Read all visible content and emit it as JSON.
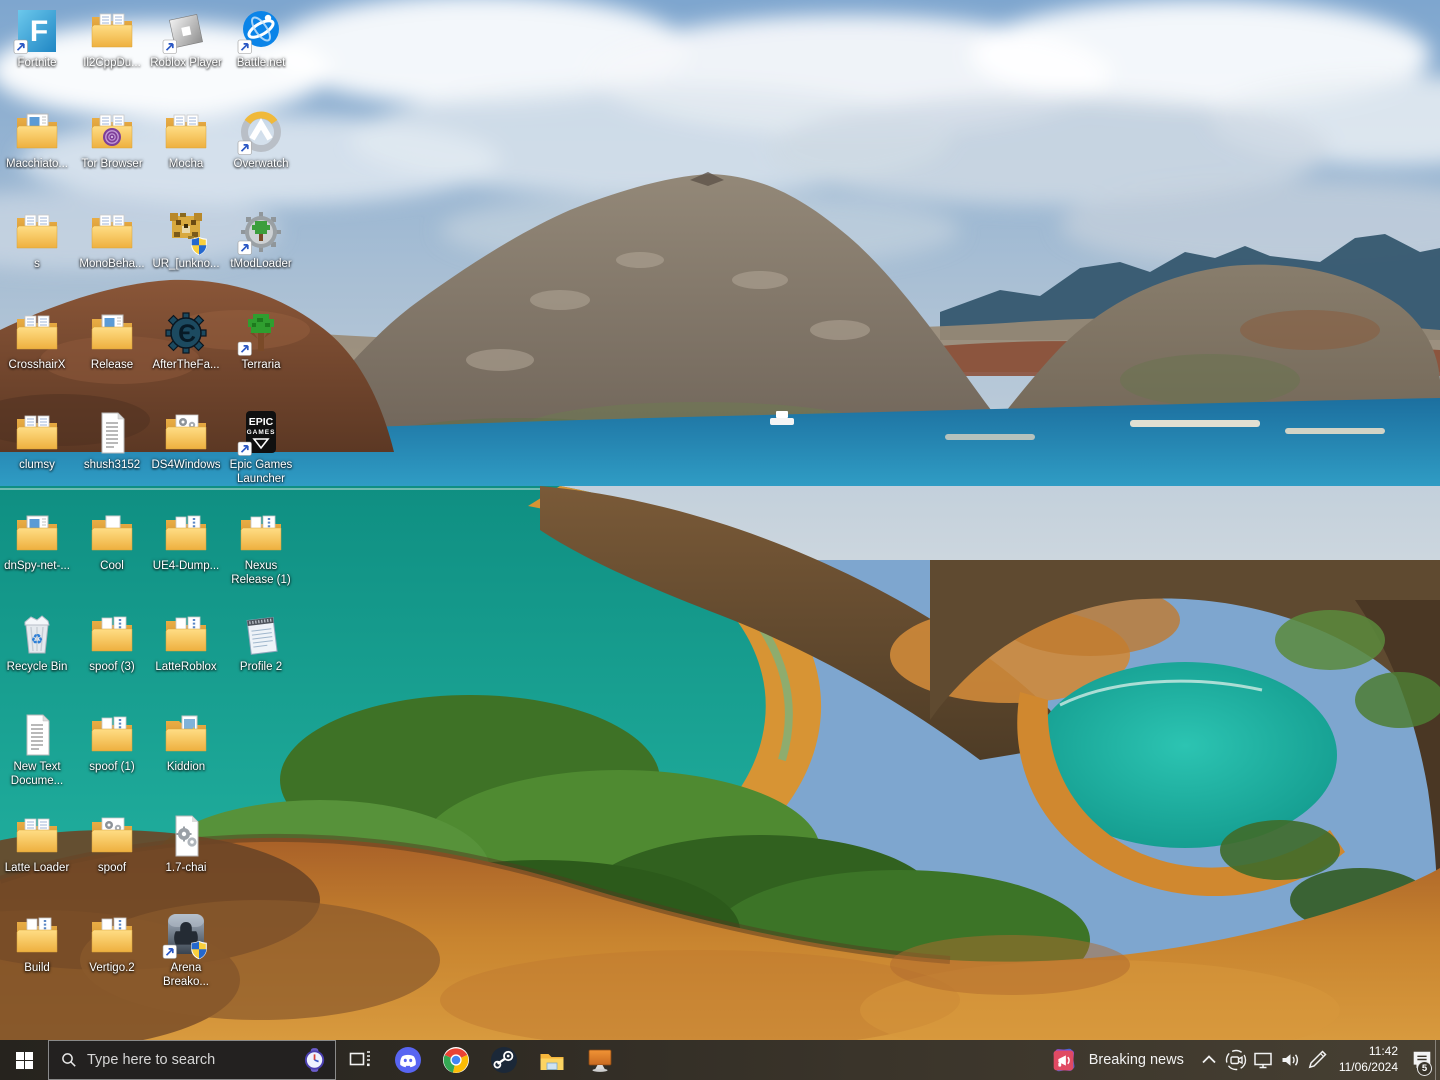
{
  "desktop": {
    "wallpaper": {
      "description": "Bartolome Island Galapagos: cloudy blue sky, distant blue peaks, tan volcanic cone, twin turquoise bays with orange crescent beaches, green scrub, golden volcanic foreground slope, small white boat on the blue channel",
      "palette": {
        "sky_top": "#7ea6cf",
        "sky_bottom": "#ccd6de",
        "ocean": "#1c6f9f",
        "bay_teal": "#12998a",
        "beach_orange": "#d79434",
        "vegetation": "#3e7226",
        "foreground_orange": "#c8842f",
        "volcano_tan": "#8d8275",
        "ridge_brown": "#7e4c34"
      }
    },
    "icons": [
      {
        "id": "fortnite",
        "label": "Fortnite",
        "type": "tile-fortnite",
        "col": 0,
        "row": 0,
        "shortcut": true,
        "shield": false
      },
      {
        "id": "il2cppdu",
        "label": "Il2CppDu...",
        "type": "folder-doc",
        "col": 1,
        "row": 0,
        "shortcut": false,
        "shield": false
      },
      {
        "id": "roblox-player",
        "label": "Roblox Player",
        "type": "tile-roblox",
        "col": 2,
        "row": 0,
        "shortcut": true,
        "shield": false
      },
      {
        "id": "battlenet",
        "label": "Battle.net",
        "type": "tile-battlenet",
        "col": 3,
        "row": 0,
        "shortcut": true,
        "shield": false
      },
      {
        "id": "macchiato",
        "label": "Macchiato...",
        "type": "folder-app",
        "col": 0,
        "row": 1,
        "shortcut": false,
        "shield": false
      },
      {
        "id": "tor-browser",
        "label": "Tor Browser",
        "type": "folder-tor",
        "col": 1,
        "row": 1,
        "shortcut": false,
        "shield": false
      },
      {
        "id": "mocha",
        "label": "Mocha",
        "type": "folder-doc",
        "col": 2,
        "row": 1,
        "shortcut": false,
        "shield": false
      },
      {
        "id": "overwatch",
        "label": "Overwatch",
        "type": "tile-overwatch",
        "col": 3,
        "row": 1,
        "shortcut": true,
        "shield": false
      },
      {
        "id": "s",
        "label": "s",
        "type": "folder-doc",
        "col": 0,
        "row": 2,
        "shortcut": false,
        "shield": false
      },
      {
        "id": "monobeha",
        "label": "MonoBeha...",
        "type": "folder-doc",
        "col": 1,
        "row": 2,
        "shortcut": false,
        "shield": false
      },
      {
        "id": "ur-unknown",
        "label": "UR_[unkno...",
        "type": "tile-leopard",
        "col": 2,
        "row": 2,
        "shortcut": false,
        "shield": true
      },
      {
        "id": "tmodloader",
        "label": "tModLoader",
        "type": "tile-tmod",
        "col": 3,
        "row": 2,
        "shortcut": true,
        "shield": false
      },
      {
        "id": "crosshairx",
        "label": "CrosshairX",
        "type": "folder-doc",
        "col": 0,
        "row": 3,
        "shortcut": false,
        "shield": false
      },
      {
        "id": "release",
        "label": "Release",
        "type": "folder-app",
        "col": 1,
        "row": 3,
        "shortcut": false,
        "shield": false
      },
      {
        "id": "afterthefa",
        "label": "AfterTheFa...",
        "type": "tile-cheatengine",
        "col": 2,
        "row": 3,
        "shortcut": false,
        "shield": false
      },
      {
        "id": "terraria",
        "label": "Terraria",
        "type": "tile-terraria",
        "col": 3,
        "row": 3,
        "shortcut": true,
        "shield": false
      },
      {
        "id": "clumsy",
        "label": "clumsy",
        "type": "folder-doc",
        "col": 0,
        "row": 4,
        "shortcut": false,
        "shield": false
      },
      {
        "id": "shush3152",
        "label": "shush3152",
        "type": "doc-text",
        "col": 1,
        "row": 4,
        "shortcut": false,
        "shield": false
      },
      {
        "id": "ds4windows",
        "label": "DS4Windows",
        "type": "folder-gear",
        "col": 2,
        "row": 4,
        "shortcut": false,
        "shield": false
      },
      {
        "id": "epic-games-launcher",
        "label": "Epic Games Launcher",
        "type": "tile-epic",
        "col": 3,
        "row": 4,
        "shortcut": true,
        "shield": false
      },
      {
        "id": "dnspy",
        "label": "dnSpy-net-...",
        "type": "folder-app",
        "col": 0,
        "row": 5,
        "shortcut": false,
        "shield": false
      },
      {
        "id": "cool",
        "label": "Cool",
        "type": "folder-blank",
        "col": 1,
        "row": 5,
        "shortcut": false,
        "shield": false
      },
      {
        "id": "ue4-dump",
        "label": "UE4-Dump...",
        "type": "folder-list",
        "col": 2,
        "row": 5,
        "shortcut": false,
        "shield": false
      },
      {
        "id": "nexus-release",
        "label": "Nexus Release (1)",
        "type": "folder-list",
        "col": 3,
        "row": 5,
        "shortcut": false,
        "shield": false
      },
      {
        "id": "recycle-bin",
        "label": "Recycle Bin",
        "type": "recycle-bin",
        "col": 0,
        "row": 6,
        "shortcut": false,
        "shield": false
      },
      {
        "id": "spoof-3",
        "label": "spoof (3)",
        "type": "folder-list",
        "col": 1,
        "row": 6,
        "shortcut": false,
        "shield": false
      },
      {
        "id": "latteroblox",
        "label": "LatteRoblox",
        "type": "folder-list",
        "col": 2,
        "row": 6,
        "shortcut": false,
        "shield": false
      },
      {
        "id": "profile-2",
        "label": "Profile 2",
        "type": "notepad",
        "col": 3,
        "row": 6,
        "shortcut": false,
        "shield": false
      },
      {
        "id": "new-text-document",
        "label": "New Text Docume...",
        "type": "doc-text",
        "col": 0,
        "row": 7,
        "shortcut": false,
        "shield": false
      },
      {
        "id": "spoof-1",
        "label": "spoof (1)",
        "type": "folder-list",
        "col": 1,
        "row": 7,
        "shortcut": false,
        "shield": false
      },
      {
        "id": "kiddion",
        "label": "Kiddion",
        "type": "folder-media",
        "col": 2,
        "row": 7,
        "shortcut": false,
        "shield": false
      },
      {
        "id": "latte-loader",
        "label": "Latte Loader",
        "type": "folder-doc",
        "col": 0,
        "row": 8,
        "shortcut": false,
        "shield": false
      },
      {
        "id": "spoof",
        "label": "spoof",
        "type": "folder-gear",
        "col": 1,
        "row": 8,
        "shortcut": false,
        "shield": false
      },
      {
        "id": "chai-17",
        "label": "1.7-chai",
        "type": "doc-gear",
        "col": 2,
        "row": 8,
        "shortcut": false,
        "shield": false
      },
      {
        "id": "build",
        "label": "Build",
        "type": "folder-list",
        "col": 0,
        "row": 9,
        "shortcut": false,
        "shield": false
      },
      {
        "id": "vertigo-2",
        "label": "Vertigo.2",
        "type": "folder-list",
        "col": 1,
        "row": 9,
        "shortcut": false,
        "shield": false
      },
      {
        "id": "arena-breakout",
        "label": "Arena Breako...",
        "type": "tile-arena",
        "col": 2,
        "row": 9,
        "shortcut": true,
        "shield": true
      }
    ]
  },
  "taskbar": {
    "search": {
      "placeholder": "Type here to search",
      "highlight_icon": "watch-emoji"
    },
    "apps": [
      {
        "id": "task-view",
        "icon": "task-view-icon"
      },
      {
        "id": "discord",
        "icon": "discord-icon"
      },
      {
        "id": "chrome",
        "icon": "chrome-icon"
      },
      {
        "id": "steam",
        "icon": "steam-icon"
      },
      {
        "id": "file-explorer",
        "icon": "file-explorer-icon"
      },
      {
        "id": "monitor-app",
        "icon": "monitor-app-icon"
      }
    ],
    "tray": {
      "news_label": "Breaking news",
      "icons": [
        {
          "id": "chevron-up",
          "icon": "chevron-up-icon"
        },
        {
          "id": "meet-now",
          "icon": "meet-now-icon"
        },
        {
          "id": "network",
          "icon": "network-icon"
        },
        {
          "id": "volume",
          "icon": "volume-icon"
        },
        {
          "id": "pen",
          "icon": "pen-icon"
        }
      ],
      "time": "11:42",
      "date": "11/06/2024",
      "notification_count": "5"
    }
  }
}
